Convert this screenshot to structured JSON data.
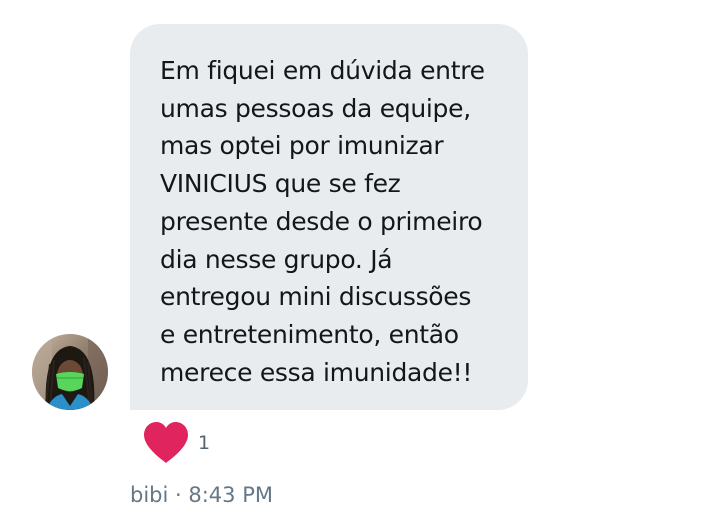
{
  "message": {
    "text": "Em fiquei em dúvida entre\numas pessoas da equipe,\nmas optei por imunizar\nVINICIUS que se fez\npresente desde o primeiro\ndia nesse grupo. Já\nentregou mini discussões\ne entretenimento, então\nmerece essa imunidade!!",
    "reaction": {
      "icon": "heart-icon",
      "count": "1",
      "color": "#e0245e"
    },
    "sender": "bibi",
    "separator": " · ",
    "time": "8:43 PM"
  },
  "colors": {
    "bubble": "#e9ecef",
    "text": "#14171a",
    "meta": "#657786"
  }
}
